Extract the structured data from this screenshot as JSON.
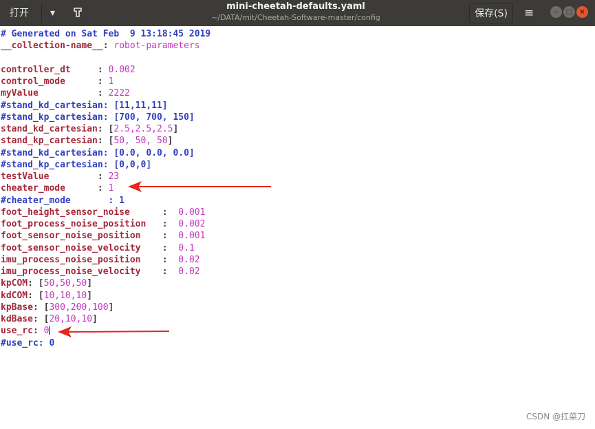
{
  "header": {
    "open_label": "打开(O)",
    "open_arrow": "▾",
    "pin_icon": "⚲",
    "title": "mini-cheetah-defaults.yaml",
    "subtitle": "~/DATA/mit/Cheetah-Software-master/config",
    "save_label": "保存(S)",
    "menu_glyph": "≡",
    "minimize_glyph": "–",
    "maximize_glyph": "□",
    "close_glyph": "×"
  },
  "editor": {
    "lines": [
      {
        "c": "# Generated on Sat Feb  9 13:18:45 2019"
      },
      {
        "k": "__collection-name__",
        "s": ": ",
        "v": "robot-parameters"
      },
      {},
      {
        "k": "controller_dt",
        "s": "     : ",
        "v": "0.002"
      },
      {
        "k": "control_mode",
        "s": "      : ",
        "v": "1"
      },
      {
        "k": "myValue",
        "s": "           : ",
        "v": "2222"
      },
      {
        "c": "#stand_kd_cartesian: [11,11,11]"
      },
      {
        "c": "#stand_kp_cartesian: [700, 700, 150]"
      },
      {
        "k": "stand_kd_cartesian",
        "s": ": [",
        "v": "2.5,2.5,2.5",
        "e": "]"
      },
      {
        "k": "stand_kp_cartesian",
        "s": ": [",
        "v": "50, 50, 50",
        "e": "]"
      },
      {
        "c": "#stand_kd_cartesian: [0.0, 0.0, 0.0]"
      },
      {
        "c": "#stand_kp_cartesian: [0,0,0]"
      },
      {
        "k": "testValue",
        "s": "         : ",
        "v": "23"
      },
      {
        "k": "cheater_mode",
        "s": "      : ",
        "v": "1"
      },
      {
        "c": "#cheater_mode       : 1"
      },
      {
        "k": "foot_height_sensor_noise",
        "s": "      :  ",
        "v": "0.001"
      },
      {
        "k": "foot_process_noise_position",
        "s": "   :  ",
        "v": "0.002"
      },
      {
        "k": "foot_sensor_noise_position",
        "s": "    :  ",
        "v": "0.001"
      },
      {
        "k": "foot_sensor_noise_velocity",
        "s": "    :  ",
        "v": "0.1"
      },
      {
        "k": "imu_process_noise_position",
        "s": "    :  ",
        "v": "0.02"
      },
      {
        "k": "imu_process_noise_velocity",
        "s": "    :  ",
        "v": "0.02"
      },
      {
        "k": "kpCOM",
        "s": ": [",
        "v": "50,50,50",
        "e": "]"
      },
      {
        "k": "kdCOM",
        "s": ": [",
        "v": "10,10,10",
        "e": "]"
      },
      {
        "k": "kpBase",
        "s": ": [",
        "v": "300,200,100",
        "e": "]"
      },
      {
        "k": "kdBase",
        "s": ": [",
        "v": "20,10,10",
        "e": "]"
      },
      {
        "k": "use_rc",
        "s": ": ",
        "v": "0",
        "caret": true
      },
      {
        "c": "#use_rc: 0"
      }
    ]
  },
  "annotations": {
    "arrow_color": "#e8251c"
  },
  "watermark": "CSDN @扛菜刀",
  "colors": {
    "comment": "#2f3fbf",
    "key": "#a5293a",
    "value": "#c238c2",
    "titlebar": "#3c3b37"
  }
}
